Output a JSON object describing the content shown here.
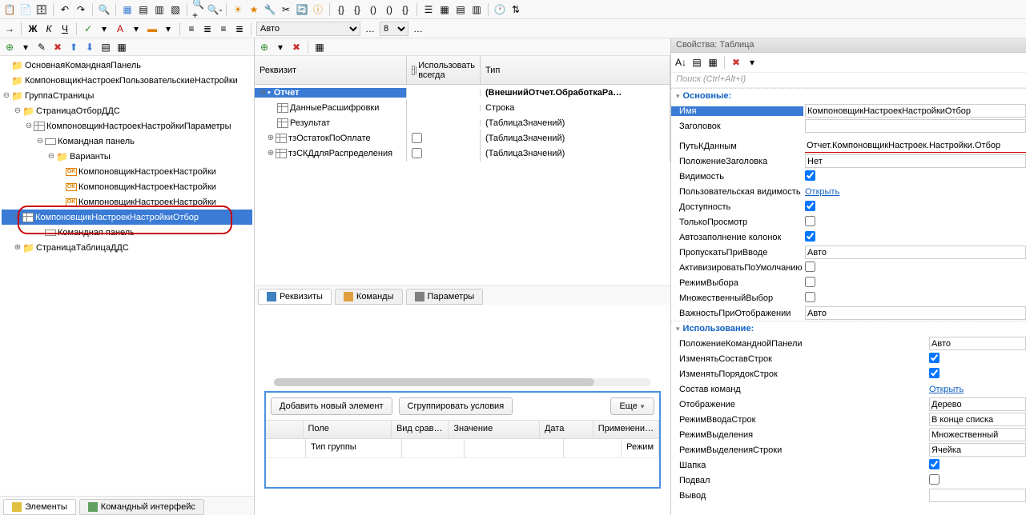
{
  "toolbar": {
    "font": "Авто",
    "size": "8"
  },
  "tree": {
    "root": "ОсновнаяКоманднаяПанель",
    "n1": "КомпоновщикНастроекПользовательскиеНастройки",
    "n2": "ГруппаСтраницы",
    "n3": "СтраницаОтборДДС",
    "n4": "КомпоновщикНастроекНастройкиПараметры",
    "n5": "Командная панель",
    "n6": "Варианты",
    "n7": "КомпоновщикНастроекНастройки",
    "n8": "КомпоновщикНастроекНастройки",
    "n9": "КомпоновщикНастроекНастройки",
    "n10": "КомпоновщикНастроекНастройкиОтбор",
    "n11": "Командная панель",
    "n12": "СтраницаТаблицаДДС"
  },
  "leftTabs": {
    "t1": "Элементы",
    "t2": "Командный интерфейс"
  },
  "reqHeader": {
    "c1": "Реквизит",
    "c2": "Использовать всегда",
    "c3": "Тип"
  },
  "req": {
    "r1": {
      "name": "Отчет",
      "type": "(ВнешнийОтчет.ОбработкаРа…"
    },
    "r2": {
      "name": "ДанныеРасшифровки",
      "type": "Строка"
    },
    "r3": {
      "name": "Результат",
      "type": "(ТаблицаЗначений)"
    },
    "r4": {
      "name": "тзОстатокПоОплате",
      "type": "(ТаблицаЗначений)"
    },
    "r5": {
      "name": "тзСКДдляРаспределения",
      "type": "(ТаблицаЗначений)"
    }
  },
  "midTabs": {
    "t1": "Реквизиты",
    "t2": "Команды",
    "t3": "Параметры"
  },
  "filter": {
    "btnAdd": "Добавить новый элемент",
    "btnGroup": "Сгруппировать условия",
    "btnMore": "Еще",
    "cols": {
      "c1": "Поле",
      "c2": "Вид срав…",
      "c3": "Значение",
      "c4": "Дата",
      "c5": "Применени…"
    },
    "row": {
      "c1": "Тип группы",
      "c5": "Режим"
    }
  },
  "props": {
    "title": "Свойства: Таблица",
    "search": "Поиск (Ctrl+Alt+I)",
    "sec1": "Основные:",
    "sec2": "Использование:",
    "name": {
      "l": "Имя",
      "v": "КомпоновщикНастроекНастройкиОтбор"
    },
    "zagolovok": "Заголовок",
    "path": {
      "l": "ПутьКДанным",
      "v": "Отчет.КомпоновщикНастроек.Настройки.Отбор"
    },
    "polZag": {
      "l": "ПоложениеЗаголовка",
      "v": "Нет"
    },
    "vis": "Видимость",
    "userVis": {
      "l": "Пользовательская видимость",
      "v": "Открыть"
    },
    "dost": "Доступность",
    "tolko": "ТолькоПросмотр",
    "autoKol": "Автозаполнение колонок",
    "propusk": {
      "l": "ПропускатьПриВводе",
      "v": "Авто"
    },
    "aktiv": "АктивизироватьПоУмолчанию",
    "rezhV": "РежимВыбора",
    "mnozh": "МножественныйВыбор",
    "vazhn": {
      "l": "ВажностьПриОтображении",
      "v": "Авто"
    },
    "polKom": {
      "l": "ПоложениеКоманднойПанели",
      "v": "Авто"
    },
    "izmSost": "ИзменятьСоставСтрок",
    "izmPor": "ИзменятьПорядокСтрок",
    "sostKom": {
      "l": "Состав команд",
      "v": "Открыть"
    },
    "otobr": {
      "l": "Отображение",
      "v": "Дерево"
    },
    "rezhVvod": {
      "l": "РежимВводаСтрок",
      "v": "В конце списка"
    },
    "rezhVyd": {
      "l": "РежимВыделения",
      "v": "Множественный"
    },
    "rezhVydS": {
      "l": "РежимВыделенияСтроки",
      "v": "Ячейка"
    },
    "shapka": "Шапка",
    "podval": "Подвал",
    "vyvod": "Вывод"
  }
}
